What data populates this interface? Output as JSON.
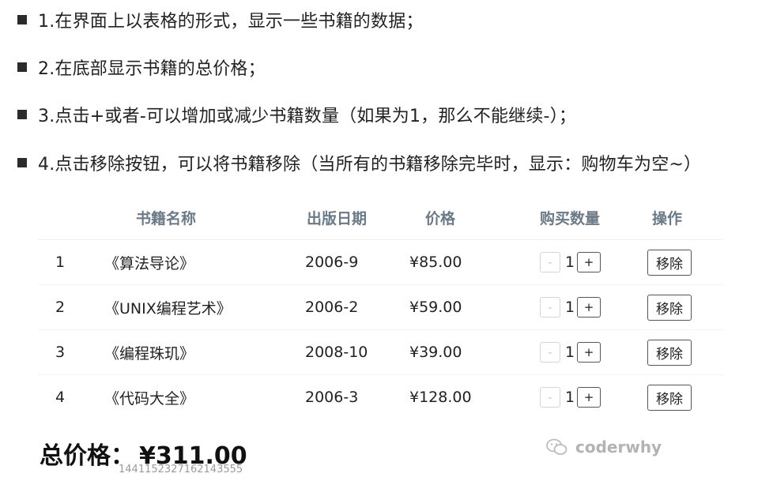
{
  "requirements": [
    "1.在界面上以表格的形式，显示一些书籍的数据；",
    "2.在底部显示书籍的总价格；",
    "3.点击+或者-可以增加或减少书籍数量（如果为1，那么不能继续-）；",
    "4.点击移除按钮，可以将书籍移除（当所有的书籍移除完毕时，显示：购物车为空~）"
  ],
  "table": {
    "headers": {
      "name": "书籍名称",
      "date": "出版日期",
      "price": "价格",
      "qty": "购买数量",
      "op": "操作"
    },
    "rows": [
      {
        "index": "1",
        "name": "《算法导论》",
        "date": "2006-9",
        "price": "¥85.00",
        "qty": "1"
      },
      {
        "index": "2",
        "name": "《UNIX编程艺术》",
        "date": "2006-2",
        "price": "¥59.00",
        "qty": "1"
      },
      {
        "index": "3",
        "name": "《编程珠玑》",
        "date": "2008-10",
        "price": "¥39.00",
        "qty": "1"
      },
      {
        "index": "4",
        "name": "《代码大全》",
        "date": "2006-3",
        "price": "¥128.00",
        "qty": "1"
      }
    ],
    "decrement_label": "-",
    "increment_label": "+",
    "remove_label": "移除"
  },
  "total": {
    "label": "总价格：",
    "value": "¥311.00"
  },
  "watermark": {
    "number": "1441152327162143555",
    "brand": "coderwhy"
  }
}
